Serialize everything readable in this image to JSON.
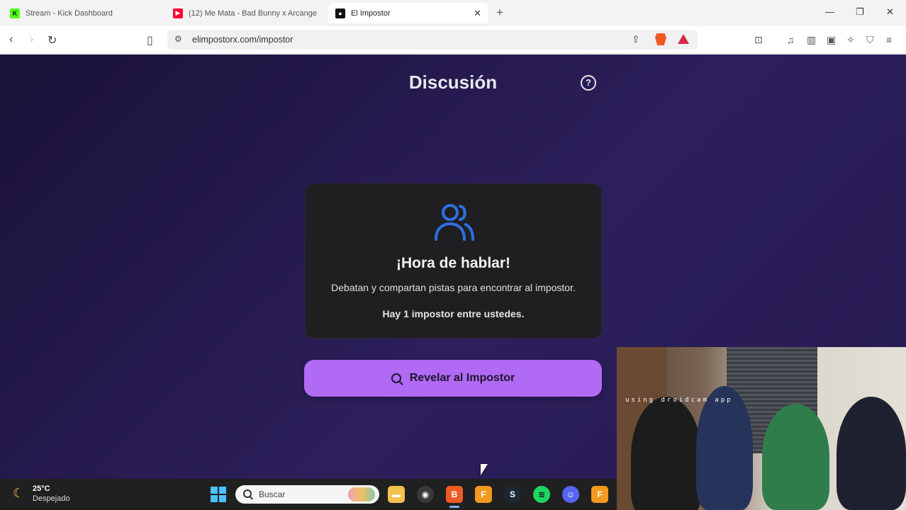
{
  "browser": {
    "tabs": [
      {
        "label": "Stream - Kick Dashboard",
        "favicon": "kick-icon",
        "color": "#53fc18"
      },
      {
        "label": "(12) Me Mata - Bad Bunny x Arcange",
        "favicon": "youtube-icon",
        "color": "#ff0033"
      },
      {
        "label": "El Impostor",
        "favicon": "impostor-icon",
        "color": "#111111"
      }
    ],
    "active_tab_index": 2,
    "url": "elimpostorx.com/impostor"
  },
  "page": {
    "title": "Discusión",
    "help_icon": "question-circle-icon",
    "card": {
      "icon": "users-icon",
      "heading": "¡Hora de hablar!",
      "description": "Debatan y compartan pistas para encontrar al impostor.",
      "impostor_count_text": "Hay 1 impostor entre ustedes."
    },
    "reveal_button": "Revelar al Impostor",
    "accent_color": "#b06af3",
    "icon_color": "#2f6fe4"
  },
  "webcam": {
    "overlay_text": "using droidcam app"
  },
  "taskbar": {
    "weather_temp": "25°C",
    "weather_desc": "Despejado",
    "search_placeholder": "Buscar",
    "apps": [
      "file-explorer-icon",
      "obs-icon",
      "brave-icon",
      "fl-studio-icon",
      "steam-icon",
      "spotify-icon",
      "discord-icon",
      "fl-studio-icon"
    ]
  }
}
